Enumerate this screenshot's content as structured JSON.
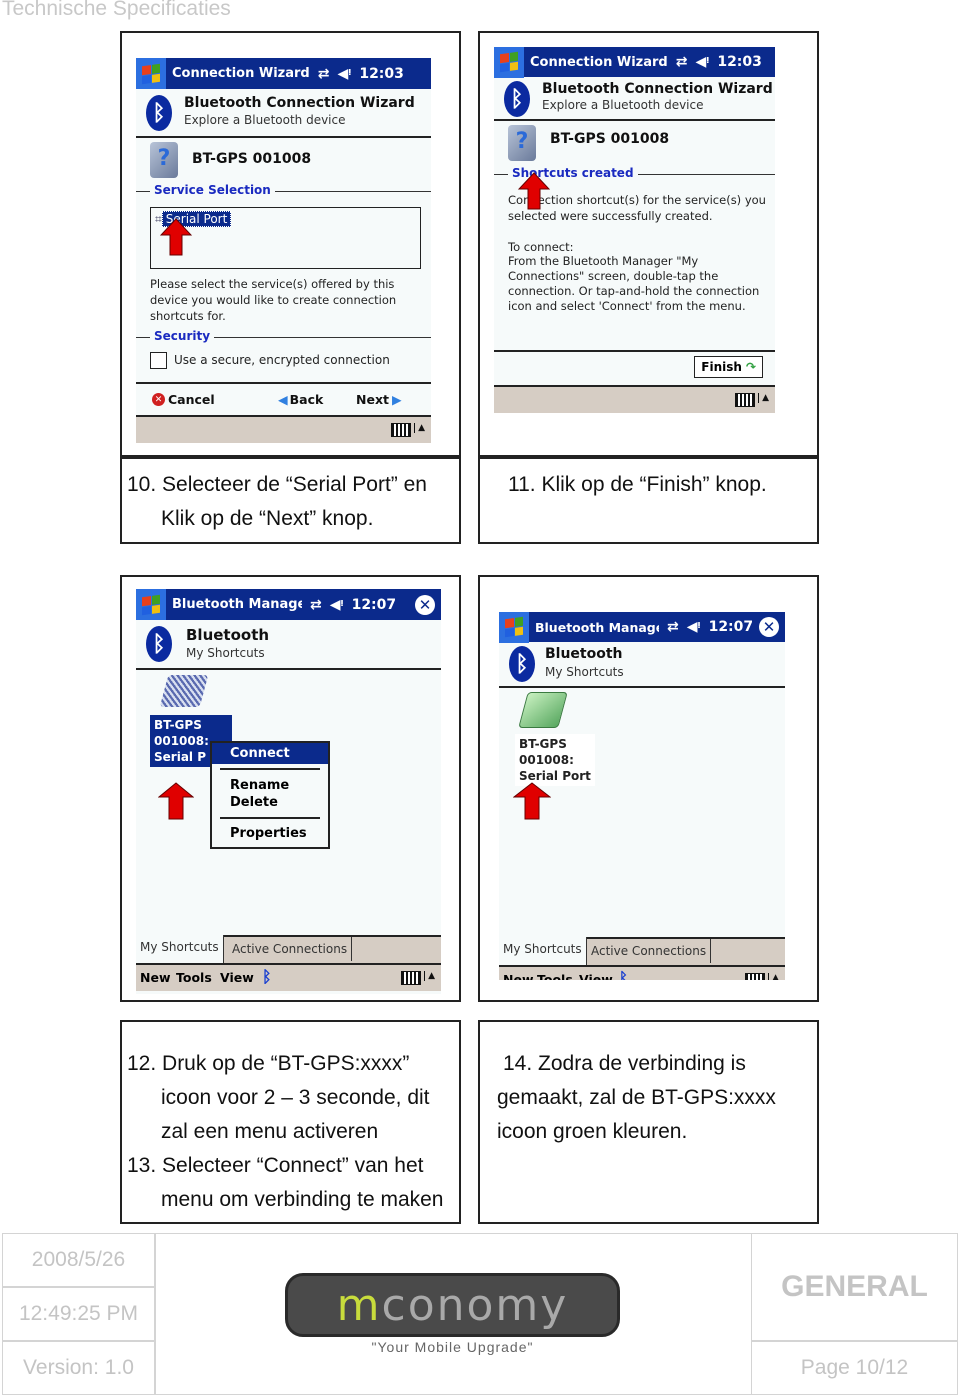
{
  "doc_header": "Technische Specificaties",
  "screens": {
    "s10": {
      "titlebar": {
        "title": "Connection Wizard",
        "time": "12:03"
      },
      "app_title": "Bluetooth Connection Wizard",
      "app_subtitle": "Explore a Bluetooth device",
      "device_name": "BT-GPS 001008",
      "group_service": "Service Selection",
      "service_item": "Serial Port",
      "instructions": "Please select the service(s) offered by this device you would like to create connection shortcuts for.",
      "group_security": "Security",
      "secure_checkbox_label": "Use a secure, encrypted connection",
      "cancel_label": "Cancel",
      "back_label": "Back",
      "next_label": "Next"
    },
    "s11": {
      "titlebar": {
        "title": "Connection Wizard",
        "time": "12:03"
      },
      "app_title": "Bluetooth Connection Wizard",
      "app_subtitle": "Explore a Bluetooth device",
      "device_name": "BT-GPS 001008",
      "group_created": "Shortcuts created",
      "created_text": "Connection shortcut(s)  for the service(s) you selected were successfully created.",
      "to_connect_heading": "To connect:",
      "to_connect_text": "From the Bluetooth Manager \"My Connections\" screen, double-tap the connection. Or tap-and-hold the connection icon and select 'Connect' from the menu.",
      "finish_label": "Finish"
    },
    "s12": {
      "titlebar": {
        "title": "Bluetooth Manage",
        "time": "12:07"
      },
      "app_title": "Bluetooth",
      "app_subtitle": "My Shortcuts",
      "shortcut_lines": [
        "BT-GPS",
        "001008:",
        "Serial P"
      ],
      "menu": [
        "Connect",
        "Rename",
        "Delete",
        "Properties"
      ],
      "tabs": [
        "My Shortcuts",
        "Active Connections"
      ],
      "menubar": [
        "New",
        "Tools",
        "View"
      ]
    },
    "s14": {
      "titlebar": {
        "title": "Bluetooth Manage",
        "time": "12:07"
      },
      "app_title": "Bluetooth",
      "app_subtitle": "My Shortcuts",
      "shortcut_lines": [
        "BT-GPS",
        "001008:",
        "Serial Port"
      ],
      "tabs": [
        "My Shortcuts",
        "Active Connections"
      ],
      "menubar": [
        "New",
        "Tools",
        "View"
      ]
    }
  },
  "captions": {
    "c10": [
      "10. Selecteer de “Serial Port” en",
      "Klik op de “Next” knop."
    ],
    "c11": [
      "11. Klik op de “Finish” knop."
    ],
    "c12": [
      "12. Druk op de “BT-GPS:xxxx”",
      "icoon voor 2 – 3 seconde, dit",
      "zal een menu activeren",
      "13. Selecteer “Connect” van het",
      "menu om verbinding te maken"
    ],
    "c14": [
      "14. Zodra de verbinding is",
      "gemaakt, zal de BT-GPS:xxxx",
      "icoon groen kleuren."
    ]
  },
  "footer": {
    "date": "2008/5/26",
    "time": "12:49:25 PM",
    "version": "Version: 1.0",
    "logo_m": "m",
    "logo_rest": "conomy",
    "tagline": "\"Your Mobile Upgrade\"",
    "category": "GENERAL",
    "page": "Page 10/12"
  },
  "colors": {
    "titlebar": "#0b2a8c",
    "group_label": "#1a2ac0",
    "arrow": "#e00000",
    "footer_text": "#c4c4c4",
    "logo_accent": "#c8dc3c"
  }
}
